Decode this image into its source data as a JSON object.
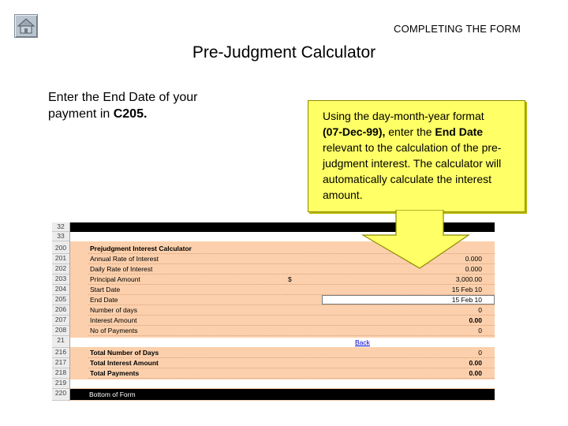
{
  "header": {
    "section_title": "COMPLETING THE FORM",
    "home_icon": "home-icon"
  },
  "page_title": "Pre-Judgment Calculator",
  "instruction": {
    "text_before": "Enter the End Date of your payment in ",
    "cell_ref": "C205",
    "text_after": "."
  },
  "callout": {
    "line1": "Using the day-month-year format",
    "format_example": "(07-Dec-99),",
    "mid": " enter the ",
    "field": "End Date",
    "rest": "relevant to the calculation of the pre-judgment interest. The calculator will automatically calculate the interest amount.",
    "background": "#ffff66"
  },
  "spreadsheet": {
    "row_numbers": [
      "32",
      "33",
      "200",
      "201",
      "202",
      "203",
      "204",
      "205",
      "206",
      "207",
      "208",
      "21",
      "216",
      "217",
      "218",
      "219",
      "220"
    ],
    "title": "Prejudgment Interest Calculator",
    "rows": [
      {
        "label": "Annual Rate of Interest",
        "value": "0.000"
      },
      {
        "label": "Daily Rate of Interest",
        "value": "0.000"
      },
      {
        "label": "Principal Amount",
        "currency": "$",
        "value": "3,000.00"
      },
      {
        "label": "Start Date",
        "value": "15 Feb 10"
      },
      {
        "label": "End Date",
        "value": "15 Feb 10"
      },
      {
        "label": "Number of days",
        "value": "0"
      },
      {
        "label": "Interest Amount",
        "value": "0.00"
      },
      {
        "label": "No of Payments",
        "value": "0"
      }
    ],
    "back_link": "Back",
    "totals": [
      {
        "label": "Total Number of Days",
        "value": "0"
      },
      {
        "label": "Total Interest Amount",
        "value": "0.00"
      },
      {
        "label": "Total Payments",
        "value": "0.00"
      }
    ],
    "bottom_label": "Bottom of Form",
    "accent_color": "#fcd0ac"
  }
}
